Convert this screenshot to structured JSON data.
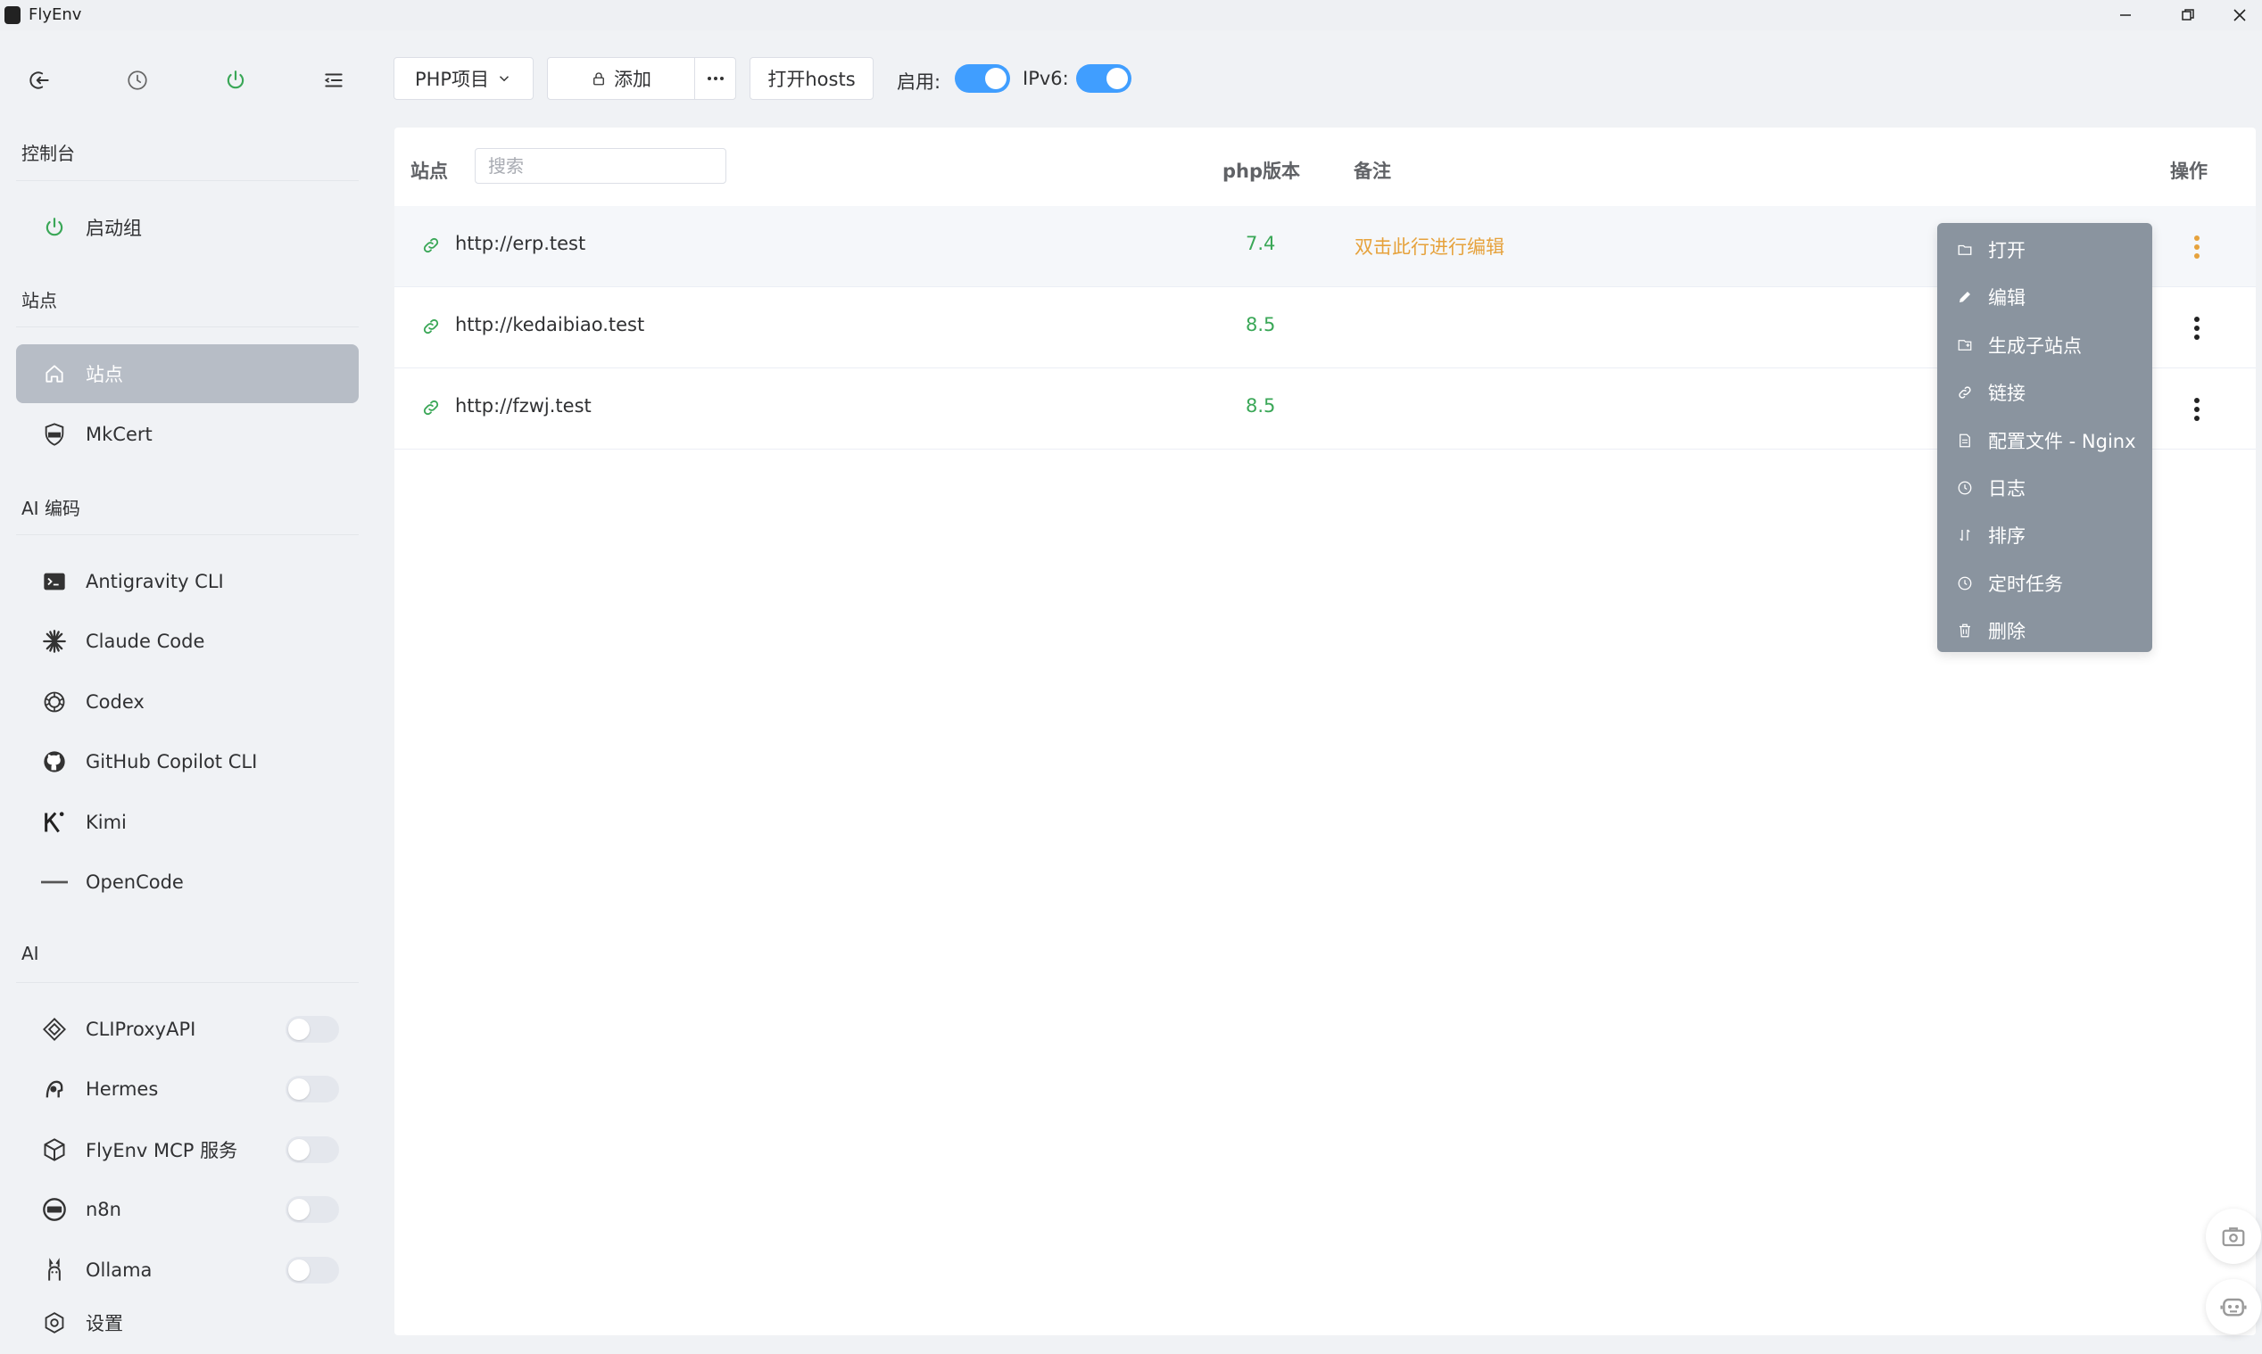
{
  "app": {
    "title": "FlyEnv"
  },
  "sidebar": {
    "sections": [
      {
        "title": "控制台",
        "items": [
          {
            "label": "启动组",
            "icon": "power-icon"
          }
        ]
      },
      {
        "title": "站点",
        "items": [
          {
            "label": "站点",
            "icon": "home-icon",
            "active": true
          },
          {
            "label": "MkCert",
            "icon": "ssl-badge-icon"
          }
        ]
      },
      {
        "title": "AI 编码",
        "items": [
          {
            "label": "Antigravity CLI",
            "icon": "terminal-icon"
          },
          {
            "label": "Claude Code",
            "icon": "claude-asterisk-icon"
          },
          {
            "label": "Codex",
            "icon": "openai-icon"
          },
          {
            "label": "GitHub Copilot CLI",
            "icon": "github-icon"
          },
          {
            "label": "Kimi",
            "icon": "kimi-icon"
          },
          {
            "label": "OpenCode",
            "icon": "opencode-icon"
          }
        ]
      },
      {
        "title": "AI",
        "items": [
          {
            "label": "CLIProxyAPI",
            "icon": "proxy-diamond-icon",
            "toggle": false
          },
          {
            "label": "Hermes",
            "icon": "hermes-icon",
            "toggle": false
          },
          {
            "label": "FlyEnv MCP 服务",
            "icon": "cube-icon",
            "toggle": false
          },
          {
            "label": "n8n",
            "icon": "n8n-icon",
            "toggle": false
          },
          {
            "label": "Ollama",
            "icon": "ollama-icon",
            "toggle": false
          }
        ]
      }
    ],
    "settings_label": "设置"
  },
  "toolbar": {
    "project_select": "PHP项目",
    "add_label": "添加",
    "hosts_label": "打开hosts",
    "enable_label": "启用:",
    "enable_on": true,
    "ipv6_label": "IPv6:",
    "ipv6_on": true
  },
  "table": {
    "col_site": "站点",
    "search_placeholder": "搜索",
    "col_php": "php版本",
    "col_note": "备注",
    "col_action": "操作",
    "rows": [
      {
        "url": "http://erp.test",
        "php": "7.4",
        "note": "双击此行进行编辑"
      },
      {
        "url": "http://kedaibiao.test",
        "php": "8.5",
        "note": ""
      },
      {
        "url": "http://fzwj.test",
        "php": "8.5",
        "note": ""
      }
    ]
  },
  "context_menu": {
    "items": [
      {
        "label": "打开",
        "icon": "folder-icon"
      },
      {
        "label": "编辑",
        "icon": "pencil-icon"
      },
      {
        "label": "生成子站点",
        "icon": "subsite-icon"
      },
      {
        "label": "链接",
        "icon": "link-icon"
      },
      {
        "label": "配置文件 - Nginx",
        "icon": "file-icon"
      },
      {
        "label": "日志",
        "icon": "clock-icon"
      },
      {
        "label": "排序",
        "icon": "sort-icon"
      },
      {
        "label": "定时任务",
        "icon": "clock-icon"
      },
      {
        "label": "删除",
        "icon": "trash-icon"
      }
    ]
  },
  "colors": {
    "accent": "#409eff",
    "green": "#3aa757",
    "warning": "#e6a23c",
    "menu_bg": "#8a949f"
  }
}
